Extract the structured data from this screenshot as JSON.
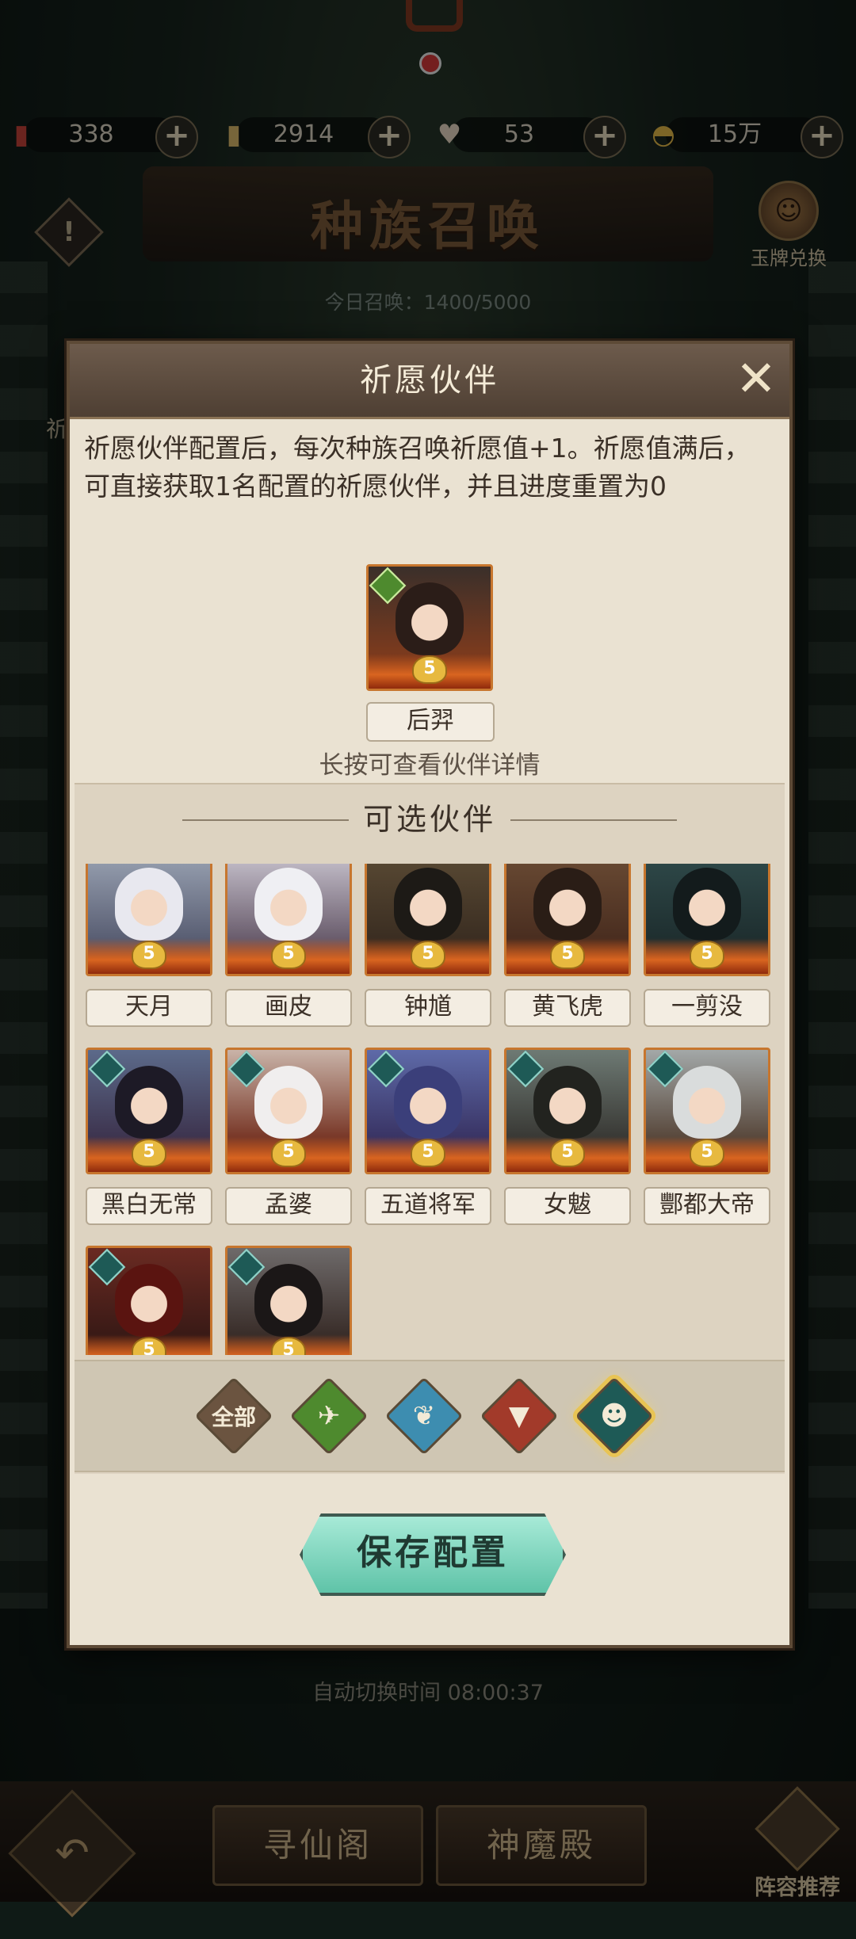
{
  "currencies": [
    {
      "icon": "ticket-red-icon",
      "value": "338"
    },
    {
      "icon": "ticket-gold-icon",
      "value": "2914"
    },
    {
      "icon": "charm-icon",
      "value": "53"
    },
    {
      "icon": "ingot-icon",
      "value": "15万"
    }
  ],
  "header": {
    "title": "种族召唤",
    "exchange_label": "玉牌兑换",
    "today_count": "今日召唤：1400/5000",
    "side_label": "祈"
  },
  "dialog": {
    "title": "祈愿伙伴",
    "intro": "祈愿伙伴配置后，每次种族召唤祈愿值+1。祈愿值满后，可直接获取1名配置的祈愿伙伴，并且进度重置为0",
    "selected": {
      "name": "后羿",
      "stars": "5"
    },
    "hint": "长按可查看伙伴详情",
    "section_title": "可选伙伴",
    "partners": [
      {
        "name": "天月",
        "stars": "5"
      },
      {
        "name": "画皮",
        "stars": "5"
      },
      {
        "name": "钟馗",
        "stars": "5"
      },
      {
        "name": "黄飞虎",
        "stars": "5"
      },
      {
        "name": "一剪没",
        "stars": "5"
      },
      {
        "name": "黑白无常",
        "stars": "5"
      },
      {
        "name": "孟婆",
        "stars": "5"
      },
      {
        "name": "五道将军",
        "stars": "5"
      },
      {
        "name": "女魃",
        "stars": "5"
      },
      {
        "name": "酆都大帝",
        "stars": "5"
      },
      {
        "name": "",
        "stars": "5"
      },
      {
        "name": "",
        "stars": "5"
      }
    ],
    "filters": [
      {
        "label": "全部",
        "icon": "all-filter",
        "active": false
      },
      {
        "label": "",
        "icon": "bird-icon",
        "active": false
      },
      {
        "label": "",
        "icon": "crane-icon",
        "active": false
      },
      {
        "label": "",
        "icon": "fox-icon",
        "active": false
      },
      {
        "label": "",
        "icon": "ghost-icon",
        "active": true
      }
    ],
    "save_label": "保存配置"
  },
  "auto_switch": "自动切换时间 08:00:37",
  "bottom_nav": {
    "tab1": "寻仙阁",
    "tab2": "神魔殿",
    "lineup": "阵容推荐"
  },
  "colors": {
    "accent": "#5fc3a8",
    "panel": "#eae2d2",
    "header": "#4e3f33"
  }
}
